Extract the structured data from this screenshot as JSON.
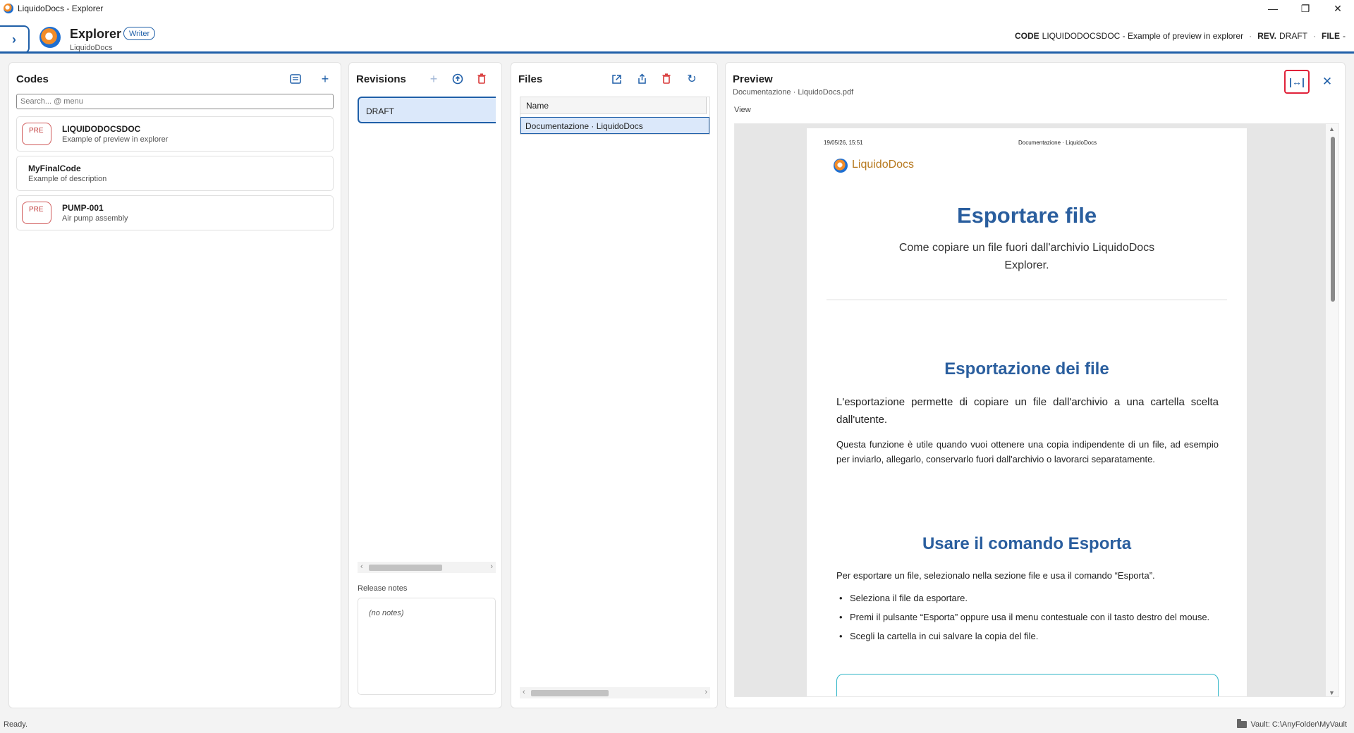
{
  "window": {
    "title": "LiquidoDocs - Explorer",
    "controls": {
      "minimize": "—",
      "maximize": "❐",
      "close": "✕"
    }
  },
  "header": {
    "title": "Explorer",
    "subtitle": "LiquidoDocs",
    "role": "Writer",
    "context": {
      "code_label": "CODE",
      "code_value": "LIQUIDODOCSDOC - Example of preview in explorer",
      "rev_label": "REV.",
      "rev_value": "DRAFT",
      "file_label": "FILE",
      "file_value": "-"
    }
  },
  "codes": {
    "title": "Codes",
    "search_placeholder": "Search... @ menu",
    "items": [
      {
        "badge": "PRE",
        "name": "LIQUIDODOCSDOC",
        "description": "Example of preview in explorer"
      },
      {
        "badge": "",
        "name": "MyFinalCode",
        "description": "Example of description"
      },
      {
        "badge": "PRE",
        "name": "PUMP-001",
        "description": "Air pump assembly"
      }
    ]
  },
  "revisions": {
    "title": "Revisions",
    "items": [
      "DRAFT"
    ],
    "release_notes_label": "Release notes",
    "release_notes_value": "(no notes)"
  },
  "files": {
    "title": "Files",
    "columns": [
      "Name"
    ],
    "rows": [
      "Documentazione · LiquidoDocs"
    ]
  },
  "preview": {
    "title": "Preview",
    "filename": "Documentazione · LiquidoDocs.pdf",
    "view_label": "View",
    "page": {
      "date": "19/05/26, 15:51",
      "running_header": "Documentazione · LiquidoDocs",
      "brand": "LiquidoDocs",
      "h1": "Esportare file",
      "lead": "Come copiare un file fuori dall'archivio LiquidoDocs Explorer.",
      "h2": "Esportazione dei file",
      "p1": "L'esportazione permette di copiare un file dall'archivio a una cartella scelta dall'utente.",
      "p2": "Questa funzione è utile quando vuoi ottenere una copia indipendente di un file, ad esempio per inviarlo, allegarlo, conservarlo fuori dall'archivio o lavorarci separatamente.",
      "h3": "Usare il comando Esporta",
      "p3": "Per esportare un file, selezionalo nella sezione file e usa il comando “Esporta”.",
      "bullets": [
        "Seleziona il file da esportare.",
        "Premi il pulsante “Esporta” oppure usa il menu contestuale con il tasto destro del mouse.",
        "Scegli la cartella in cui salvare la copia del file."
      ]
    }
  },
  "status": {
    "left": "Ready.",
    "vault": "Vault: C:\\AnyFolder\\MyVault"
  },
  "colors": {
    "accent": "#1f5fa8",
    "danger": "#d93a3a",
    "selection": "#dbe8fa",
    "heading": "#2a5e9e",
    "brand_orange": "#b7791f"
  }
}
